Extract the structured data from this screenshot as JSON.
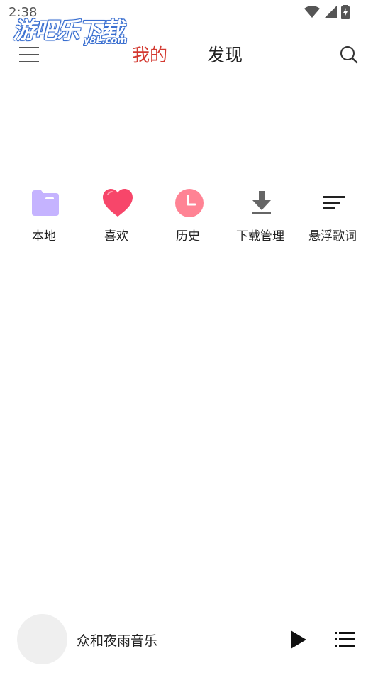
{
  "status_bar": {
    "time": "2:38",
    "icons": [
      "wifi-icon",
      "signal-icon",
      "battery-charging-icon"
    ]
  },
  "watermark": {
    "main": "游吧乐下载",
    "sub": "y8L.com"
  },
  "header": {
    "menu_icon": "menu-icon",
    "tabs": [
      {
        "label": "我的",
        "active": true,
        "color": "#d33a31"
      },
      {
        "label": "发现",
        "active": false,
        "color": "#222222"
      }
    ],
    "search_icon": "search-icon"
  },
  "quick_actions": [
    {
      "label": "本地",
      "icon": "folder-icon",
      "color": "#c5b3ff"
    },
    {
      "label": "喜欢",
      "icon": "heart-icon",
      "color": "#f7466a"
    },
    {
      "label": "历史",
      "icon": "clock-icon",
      "color": "#ff7b8c"
    },
    {
      "label": "下载管理",
      "icon": "download-icon",
      "color": "#666666"
    },
    {
      "label": "悬浮歌词",
      "icon": "lyrics-icon",
      "color": "#222222"
    }
  ],
  "player": {
    "title": "众和夜雨音乐",
    "play_icon": "play-icon",
    "playlist_icon": "playlist-icon"
  }
}
